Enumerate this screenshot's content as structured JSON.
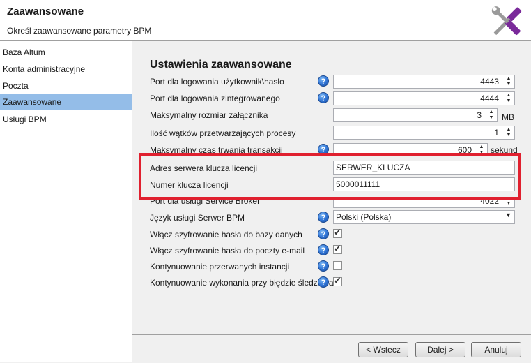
{
  "header": {
    "title": "Zaawansowane",
    "subtitle": "Określ zaawansowane parametry BPM",
    "logo_icon": "tools-icon"
  },
  "sidebar": {
    "items": [
      {
        "label": "Baza Altum",
        "selected": false
      },
      {
        "label": "Konta administracyjne",
        "selected": false
      },
      {
        "label": "Poczta",
        "selected": false
      },
      {
        "label": "Zaawansowane",
        "selected": true
      },
      {
        "label": "Usługi BPM",
        "selected": false
      }
    ]
  },
  "main": {
    "section_title": "Ustawienia zaawansowane",
    "help_glyph": "?",
    "check_glyph": "✓",
    "rows": [
      {
        "label": "Port dla logowania użytkownik\\hasło",
        "value": "4443"
      },
      {
        "label": "Port dla logowania zintegrowanego",
        "value": "4444"
      },
      {
        "label": "Maksymalny rozmiar załącznika",
        "value": "3",
        "unit": "MB"
      },
      {
        "label": "Ilość wątków przetwarzających procesy",
        "value": "1"
      },
      {
        "label": "Maksymalny czas trwania transakcji",
        "value": "600",
        "unit": "sekund"
      },
      {
        "label": "Adres serwera klucza licencji",
        "value": "SERWER_KLUCZA"
      },
      {
        "label": "Numer klucza licencji",
        "value": "5000011111"
      },
      {
        "label": "Port dla usługi Service Broker",
        "value": "4022"
      },
      {
        "label": "Język usługi Serwer BPM",
        "value": "Polski (Polska)"
      },
      {
        "label": "Włącz szyfrowanie hasła do bazy danych",
        "checked": true
      },
      {
        "label": "Włącz szyfrowanie hasła do poczty e-mail",
        "checked": true
      },
      {
        "label": "Kontynuowanie przerwanych instancji",
        "checked": false
      },
      {
        "label": "Kontynuowanie wykonania przy błędzie śledzenia",
        "checked": true
      }
    ]
  },
  "footer": {
    "back_label": "< Wstecz",
    "next_label": "Dalej >",
    "cancel_label": "Anuluj"
  },
  "colors": {
    "selection": "#94bde8",
    "highlight": "#e0202f"
  }
}
